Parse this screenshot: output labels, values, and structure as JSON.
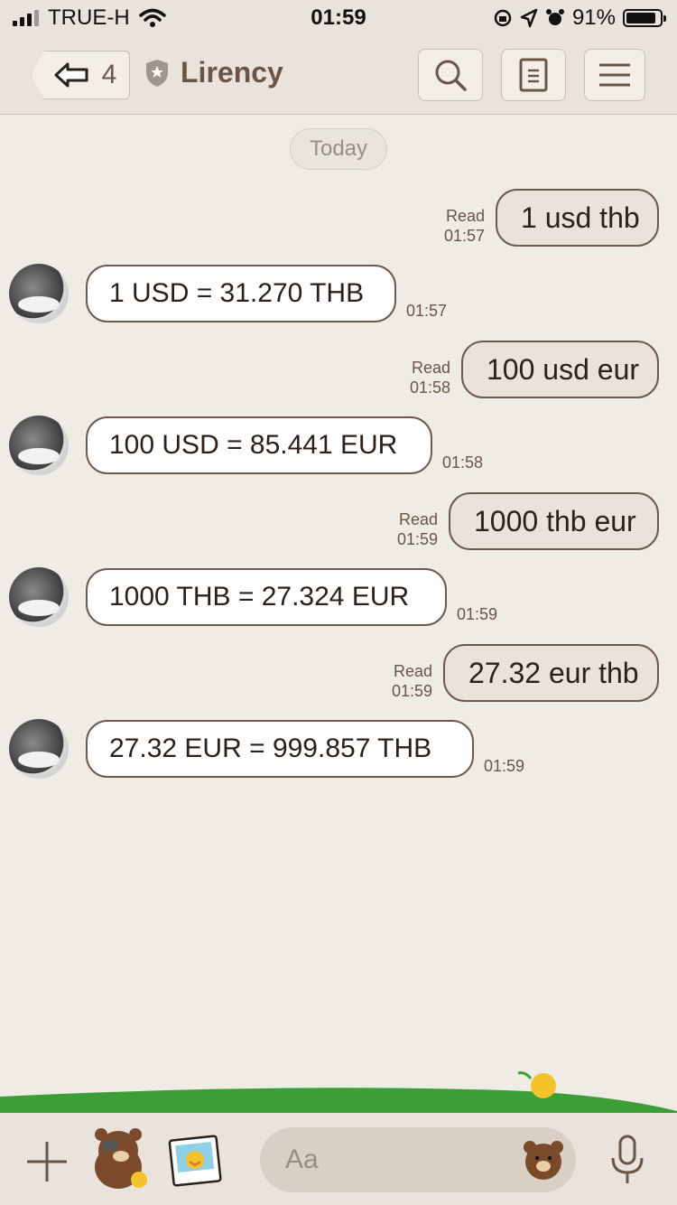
{
  "status_bar": {
    "carrier": "TRUE-H",
    "time": "01:59",
    "battery": "91%",
    "battery_level": 0.91
  },
  "header": {
    "back_count": "4",
    "title": "Lirency"
  },
  "date_divider": "Today",
  "messages": [
    {
      "side": "out",
      "text": "1 usd thb",
      "read": "Read",
      "time": "01:57"
    },
    {
      "side": "in",
      "text": "1 USD = 31.270 THB",
      "time": "01:57"
    },
    {
      "side": "out",
      "text": "100 usd eur",
      "read": "Read",
      "time": "01:58"
    },
    {
      "side": "in",
      "text": "100 USD = 85.441 EUR",
      "time": "01:58"
    },
    {
      "side": "out",
      "text": "1000 thb eur",
      "read": "Read",
      "time": "01:59"
    },
    {
      "side": "in",
      "text": "1000 THB = 27.324 EUR",
      "time": "01:59"
    },
    {
      "side": "out",
      "text": "27.32 eur thb",
      "read": "Read",
      "time": "01:59"
    },
    {
      "side": "in",
      "text": "27.32 EUR = 999.857 THB",
      "time": "01:59"
    }
  ],
  "input": {
    "placeholder": "Aa"
  },
  "icons": [
    "signal-icon",
    "wifi-icon",
    "lock-rotation-icon",
    "location-icon",
    "alarm-icon",
    "battery-icon",
    "back-arrow-icon",
    "shield-star-icon",
    "search-icon",
    "notes-icon",
    "menu-icon",
    "plus-icon",
    "sticker-icon",
    "photo-sticker-icon",
    "emoji-icon",
    "microphone-icon"
  ],
  "colors": {
    "background": "#efebe5",
    "header": "#e9e3db",
    "bubble_border": "#6e5a4b",
    "accent_text": "#6b5544",
    "hill": "#3c9e36"
  }
}
